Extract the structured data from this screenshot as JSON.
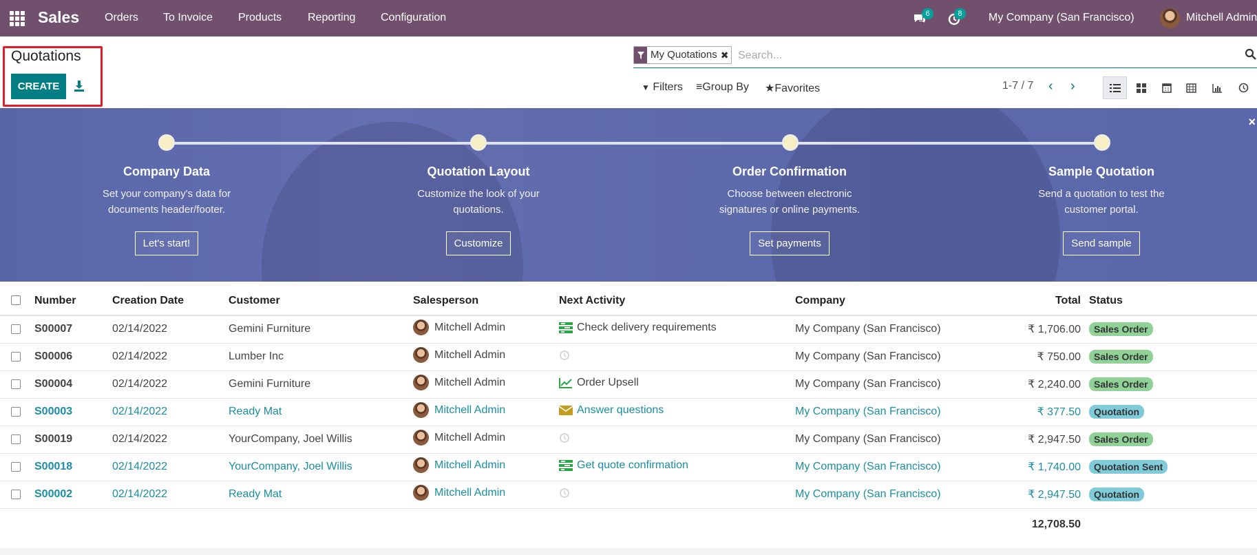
{
  "nav": {
    "app": "Sales",
    "menu": [
      "Orders",
      "To Invoice",
      "Products",
      "Reporting",
      "Configuration"
    ],
    "messages_count": "6",
    "activities_count": "8",
    "company": "My Company (San Francisco)",
    "user": "Mitchell Admin"
  },
  "control": {
    "title": "Quotations",
    "create_label": "CREATE",
    "facet": "My Quotations",
    "search_placeholder": "Search...",
    "filters": "Filters",
    "group_by": "Group By",
    "favorites": "Favorites",
    "pager": "1-7 / 7"
  },
  "banner": {
    "close": "×",
    "steps": [
      {
        "title": "Company Data",
        "text1": "Set your company's data for",
        "text2": "documents header/footer.",
        "button": "Let's start!"
      },
      {
        "title": "Quotation Layout",
        "text1": "Customize the look of your",
        "text2": "quotations.",
        "button": "Customize"
      },
      {
        "title": "Order Confirmation",
        "text1": "Choose between electronic",
        "text2": "signatures or online payments.",
        "button": "Set payments"
      },
      {
        "title": "Sample Quotation",
        "text1": "Send a quotation to test the",
        "text2": "customer portal.",
        "button": "Send sample"
      }
    ]
  },
  "table": {
    "headers": [
      "Number",
      "Creation Date",
      "Customer",
      "Salesperson",
      "Next Activity",
      "Company",
      "Total",
      "Status"
    ],
    "rows": [
      {
        "number": "S00007",
        "date": "02/14/2022",
        "customer": "Gemini Furniture",
        "salesperson": "Mitchell Admin",
        "activity": "Check delivery requirements",
        "company": "My Company (San Francisco)",
        "total": "₹ 1,706.00",
        "status": "Sales Order"
      },
      {
        "number": "S00006",
        "date": "02/14/2022",
        "customer": "Lumber Inc",
        "salesperson": "Mitchell Admin",
        "activity": "",
        "company": "My Company (San Francisco)",
        "total": "₹ 750.00",
        "status": "Sales Order"
      },
      {
        "number": "S00004",
        "date": "02/14/2022",
        "customer": "Gemini Furniture",
        "salesperson": "Mitchell Admin",
        "activity": "Order Upsell",
        "company": "My Company (San Francisco)",
        "total": "₹ 2,240.00",
        "status": "Sales Order"
      },
      {
        "number": "S00003",
        "date": "02/14/2022",
        "customer": "Ready Mat",
        "salesperson": "Mitchell Admin",
        "activity": "Answer questions",
        "company": "My Company (San Francisco)",
        "total": "₹ 377.50",
        "status": "Quotation"
      },
      {
        "number": "S00019",
        "date": "02/14/2022",
        "customer": "YourCompany, Joel Willis",
        "salesperson": "Mitchell Admin",
        "activity": "",
        "company": "My Company (San Francisco)",
        "total": "₹ 2,947.50",
        "status": "Sales Order"
      },
      {
        "number": "S00018",
        "date": "02/14/2022",
        "customer": "YourCompany, Joel Willis",
        "salesperson": "Mitchell Admin",
        "activity": "Get quote confirmation",
        "company": "My Company (San Francisco)",
        "total": "₹ 1,740.00",
        "status": "Quotation Sent"
      },
      {
        "number": "S00002",
        "date": "02/14/2022",
        "customer": "Ready Mat",
        "salesperson": "Mitchell Admin",
        "activity": "",
        "company": "My Company (San Francisco)",
        "total": "₹ 2,947.50",
        "status": "Quotation"
      }
    ],
    "grand_total": "12,708.50"
  },
  "colors": {
    "navbar": "#71506d",
    "primary": "#017e84",
    "link": "#1a8ea3",
    "sales_order": "#8fd197",
    "quotation": "#7fcbd9"
  }
}
